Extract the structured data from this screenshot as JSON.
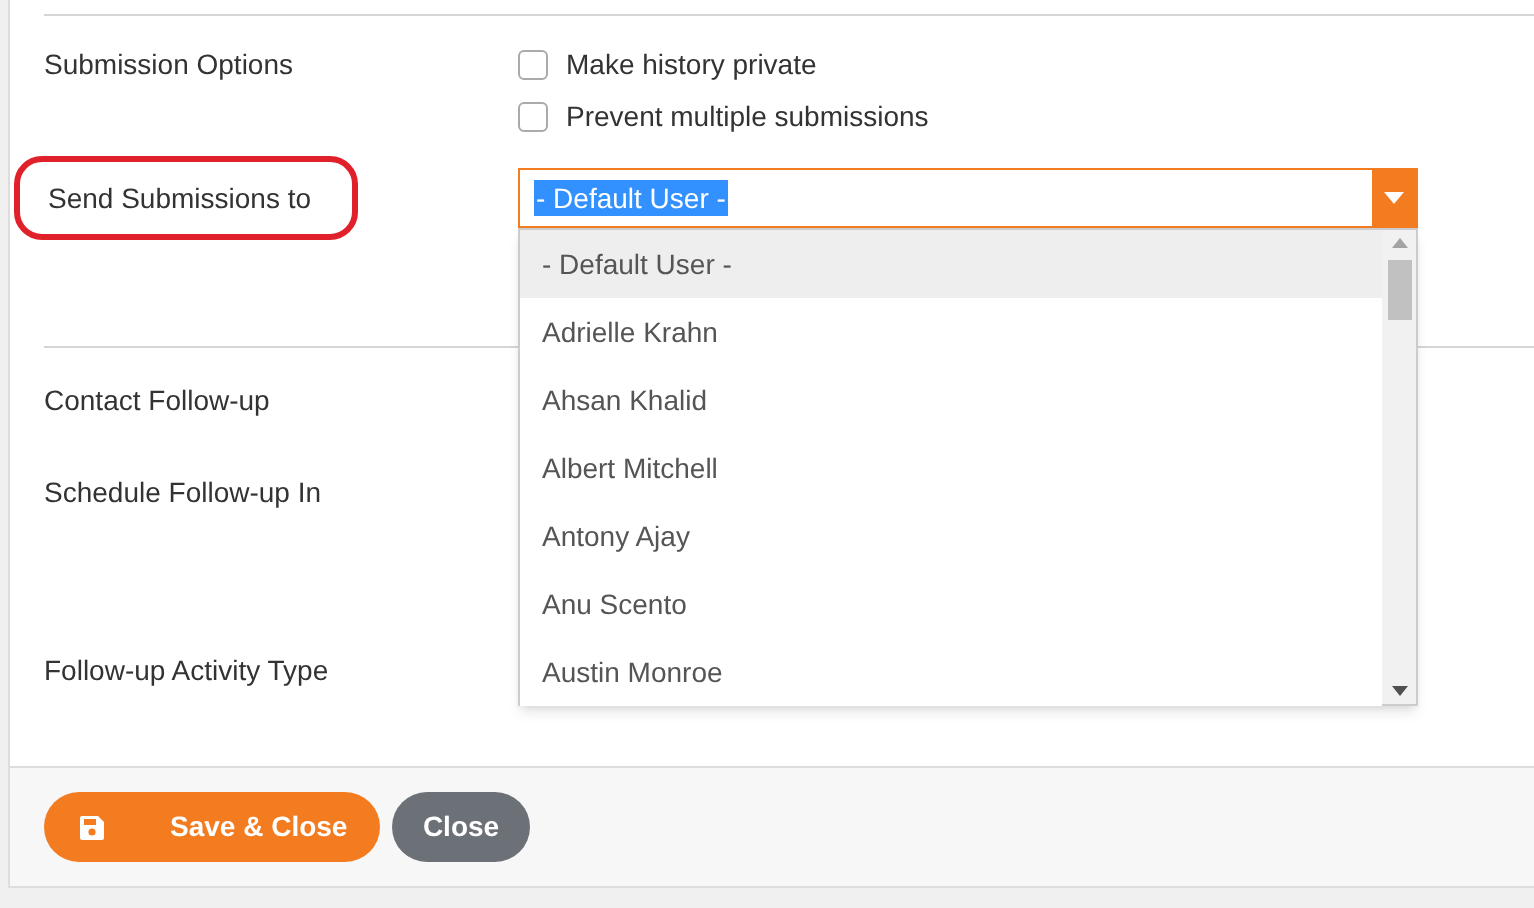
{
  "submission_options": {
    "label": "Submission Options",
    "checkboxes": [
      {
        "label": "Make history private",
        "checked": false
      },
      {
        "label": "Prevent multiple submissions",
        "checked": false
      }
    ]
  },
  "send_to": {
    "label": "Send Submissions to",
    "highlighted": true,
    "value": "- Default User -",
    "expanded": true,
    "options": [
      {
        "label": "- Default User -",
        "selected": true
      },
      {
        "label": "Adrielle Krahn",
        "selected": false
      },
      {
        "label": "Ahsan Khalid",
        "selected": false
      },
      {
        "label": "Albert Mitchell",
        "selected": false
      },
      {
        "label": "Antony Ajay",
        "selected": false
      },
      {
        "label": "Anu Scento",
        "selected": false
      },
      {
        "label": "Austin Monroe",
        "selected": false
      }
    ]
  },
  "follow_up_labels": [
    "Contact Follow-up",
    "Schedule Follow-up In",
    "Follow-up Activity Type"
  ],
  "buttons": [
    {
      "label": "Save & Close",
      "kind": "primary"
    },
    {
      "label": "Close",
      "kind": "secondary"
    }
  ]
}
